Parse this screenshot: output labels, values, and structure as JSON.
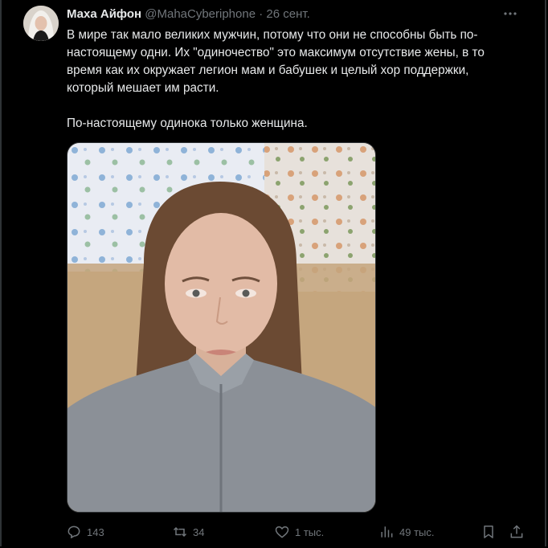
{
  "tweet": {
    "author_name": "Маха Айфон",
    "author_handle": "@MahaCyberiphone",
    "separator": "·",
    "date": "26 сент.",
    "text_paragraph_1": "В мире так мало великих мужчин, потому что они не способны быть по-настоящему одни. Их \"одиночество\" это максимум отсутствие жены, в то время как их окружает легион мам и бабушек и целый хор поддержки, который мешает им расти.",
    "text_paragraph_2": "По-настоящему одинока только женщина."
  },
  "actions": {
    "replies": "143",
    "reposts": "34",
    "likes": "1 тыс.",
    "views": "49 тыс."
  },
  "icons": {
    "more": "more-horizontal-icon",
    "reply": "reply-bubble-icon",
    "repost": "repost-arrows-icon",
    "like": "heart-icon",
    "views": "views-bar-chart-icon",
    "bookmark": "bookmark-icon",
    "share": "share-upload-icon"
  },
  "colors": {
    "background": "#000000",
    "text": "#e7e9ea",
    "muted": "#71767b",
    "border": "#2f3336"
  }
}
